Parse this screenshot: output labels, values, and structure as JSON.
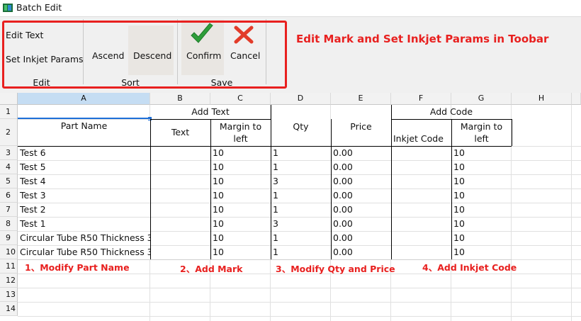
{
  "window": {
    "title": "Batch Edit"
  },
  "toolbar": {
    "edit_group": {
      "label": "Edit",
      "edit_text": "Edit Text",
      "set_inkjet_params": "Set Inkjet Params"
    },
    "sort_group": {
      "label": "Sort",
      "ascend": "Ascend",
      "descend": "Descend"
    },
    "save_group": {
      "label": "Save",
      "confirm": "Confirm",
      "cancel": "Cancel"
    },
    "annotation": "Edit Mark and Set Inkjet Params in Toobar"
  },
  "grid": {
    "column_letters": [
      "A",
      "B",
      "C",
      "D",
      "E",
      "F",
      "G",
      "H"
    ],
    "row_numbers": [
      "1",
      "2",
      "3",
      "4",
      "5",
      "6",
      "7",
      "8",
      "9",
      "10",
      "11",
      "12",
      "13",
      "14"
    ],
    "header": {
      "part_name": "Part Name",
      "add_text": "Add Text",
      "text": "Text",
      "margin_left_1": "Margin to",
      "margin_left_2": "left",
      "qty": "Qty",
      "price": "Price",
      "add_code": "Add Code",
      "inkjet_code": "Inkjet Code"
    },
    "rows": [
      {
        "part": "Test 6",
        "margin": "10",
        "qty": "1",
        "price": "0.00",
        "code_margin": "10"
      },
      {
        "part": "Test 5",
        "margin": "10",
        "qty": "1",
        "price": "0.00",
        "code_margin": "10"
      },
      {
        "part": "Test 4",
        "margin": "10",
        "qty": "3",
        "price": "0.00",
        "code_margin": "10"
      },
      {
        "part": "Test 3",
        "margin": "10",
        "qty": "1",
        "price": "0.00",
        "code_margin": "10"
      },
      {
        "part": "Test 2",
        "margin": "10",
        "qty": "1",
        "price": "0.00",
        "code_margin": "10"
      },
      {
        "part": "Test 1",
        "margin": "10",
        "qty": "3",
        "price": "0.00",
        "code_margin": "10"
      },
      {
        "part": "Circular Tube R50 Thickness 3",
        "margin": "10",
        "qty": "1",
        "price": "0.00",
        "code_margin": "10"
      },
      {
        "part": "Circular Tube R50 Thickness 3",
        "margin": "10",
        "qty": "1",
        "price": "0.00",
        "code_margin": "10"
      }
    ]
  },
  "notes": {
    "modify_part_name": "1、Modify Part Name",
    "add_mark": "2、Add Mark",
    "modify_qty_price": "3、Modify Qty and Price",
    "add_inkjet_code": "4、Add Inkjet Code"
  },
  "colors": {
    "accent_red": "#e8201f",
    "selected_header": "#c5ddf3",
    "confirm_green": "#2e9e3a",
    "cancel_red": "#e23c2a"
  }
}
